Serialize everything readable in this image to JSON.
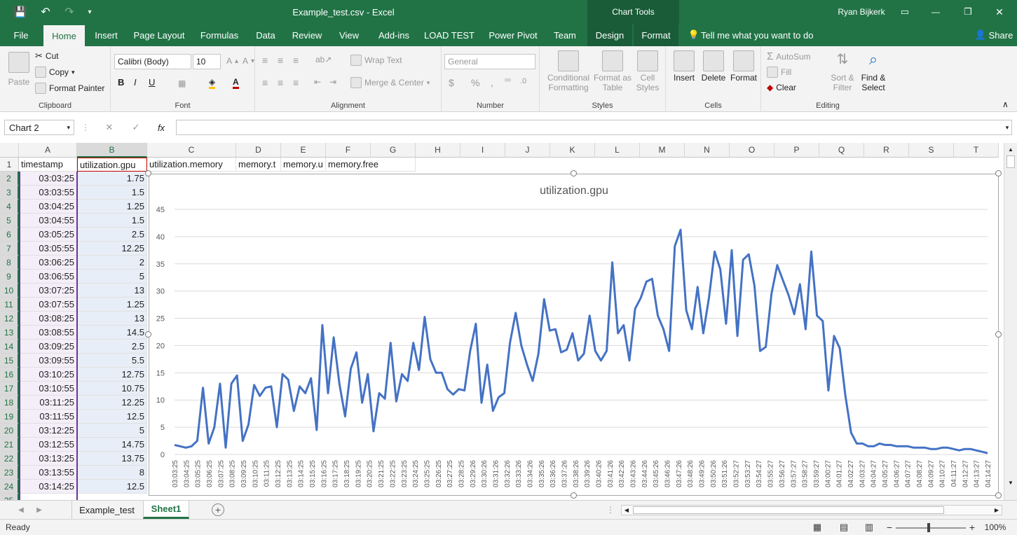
{
  "window": {
    "title": "Example_test.csv  -  Excel",
    "context_tab": "Chart Tools",
    "user": "Ryan Bijkerk",
    "minimize": "—",
    "restore": "❐",
    "close": "✕"
  },
  "tabs": [
    "File",
    "Home",
    "Insert",
    "Page Layout",
    "Formulas",
    "Data",
    "Review",
    "View",
    "Add-ins",
    "LOAD TEST",
    "Power Pivot",
    "Team",
    "Design",
    "Format"
  ],
  "tell_me": "Tell me what you want to do",
  "share": "Share",
  "ribbon": {
    "clipboard": {
      "label": "Clipboard",
      "paste": "Paste",
      "cut": "Cut",
      "copy": "Copy",
      "format_painter": "Format Painter"
    },
    "font": {
      "label": "Font",
      "family": "Calibri (Body)",
      "size": "10",
      "bold": "B",
      "italic": "I",
      "underline": "U"
    },
    "alignment": {
      "label": "Alignment",
      "wrap": "Wrap Text",
      "merge": "Merge & Center"
    },
    "number": {
      "label": "Number",
      "format": "General",
      "currency": "$",
      "percent": "%",
      "comma": ",",
      "inc": "⁰⁰",
      "dec": ".0"
    },
    "styles": {
      "label": "Styles",
      "conditional": "Conditional",
      "conditional2": "Formatting",
      "format_as": "Format as",
      "format_as2": "Table",
      "cell": "Cell",
      "cell2": "Styles"
    },
    "cells": {
      "label": "Cells",
      "insert": "Insert",
      "delete": "Delete",
      "format": "Format"
    },
    "editing": {
      "label": "Editing",
      "autosum": "AutoSum",
      "fill": "Fill",
      "clear": "Clear",
      "sort": "Sort &",
      "sort2": "Filter",
      "find": "Find &",
      "find2": "Select"
    }
  },
  "formula_bar": {
    "name_box": "Chart 2",
    "cancel": "✕",
    "enter": "✓",
    "fx": "fx",
    "value": ""
  },
  "columns": [
    "A",
    "B",
    "C",
    "D",
    "E",
    "F",
    "G",
    "H",
    "I",
    "J",
    "K",
    "L",
    "M",
    "N",
    "O",
    "P",
    "Q",
    "R",
    "S",
    "T"
  ],
  "header_row": [
    "timestamp",
    "utilization.gpu",
    "utilization.memory",
    "memory.t",
    "memory.u",
    "memory.free"
  ],
  "rows": [
    [
      "03:03:25",
      "1.75"
    ],
    [
      "03:03:55",
      "1.5"
    ],
    [
      "03:04:25",
      "1.25"
    ],
    [
      "03:04:55",
      "1.5"
    ],
    [
      "03:05:25",
      "2.5"
    ],
    [
      "03:05:55",
      "12.25"
    ],
    [
      "03:06:25",
      "2"
    ],
    [
      "03:06:55",
      "5"
    ],
    [
      "03:07:25",
      "13"
    ],
    [
      "03:07:55",
      "1.25"
    ],
    [
      "03:08:25",
      "13"
    ],
    [
      "03:08:55",
      "14.5"
    ],
    [
      "03:09:25",
      "2.5"
    ],
    [
      "03:09:55",
      "5.5"
    ],
    [
      "03:10:25",
      "12.75"
    ],
    [
      "03:10:55",
      "10.75"
    ],
    [
      "03:11:25",
      "12.25"
    ],
    [
      "03:11:55",
      "12.5"
    ],
    [
      "03:12:25",
      "5"
    ],
    [
      "03:12:55",
      "14.75"
    ],
    [
      "03:13:25",
      "13.75"
    ],
    [
      "03:13:55",
      "8"
    ],
    [
      "03:14:25",
      "12.5"
    ]
  ],
  "sheets": [
    "Example_test",
    "Sheet1"
  ],
  "active_sheet": "Sheet1",
  "status": {
    "ready": "Ready",
    "zoom": "100%"
  },
  "chart_data": {
    "type": "line",
    "title": "utilization.gpu",
    "ylim": [
      0,
      45
    ],
    "yticks": [
      0,
      5,
      10,
      15,
      20,
      25,
      30,
      35,
      40,
      45
    ],
    "grid": true,
    "color": "#4472C4",
    "x_tick_labels": [
      "03:03:25",
      "03:04:25",
      "03:05:25",
      "03:06:25",
      "03:07:25",
      "03:08:25",
      "03:09:25",
      "03:10:25",
      "03:11:25",
      "03:12:25",
      "03:13:25",
      "03:14:25",
      "03:15:25",
      "03:16:25",
      "03:17:25",
      "03:18:25",
      "03:19:25",
      "03:20:25",
      "03:21:25",
      "03:22:25",
      "03:23:25",
      "03:24:25",
      "03:25:25",
      "03:26:25",
      "03:27:25",
      "03:28:25",
      "03:29:26",
      "03:30:26",
      "03:31:26",
      "03:32:26",
      "03:33:26",
      "03:34:26",
      "03:35:26",
      "03:36:26",
      "03:37:26",
      "03:38:26",
      "03:39:26",
      "03:40:26",
      "03:41:26",
      "03:42:26",
      "03:43:26",
      "03:44:26",
      "03:45:26",
      "03:46:26",
      "03:47:26",
      "03:48:26",
      "03:49:26",
      "03:50:26",
      "03:51:26",
      "03:52:27",
      "03:53:27",
      "03:54:27",
      "03:55:27",
      "03:56:27",
      "03:57:27",
      "03:58:27",
      "03:59:27",
      "04:00:27",
      "04:01:27",
      "04:02:27",
      "04:03:27",
      "04:04:27",
      "04:05:27",
      "04:06:27",
      "04:07:27",
      "04:08:27",
      "04:09:27",
      "04:10:27",
      "04:11:27",
      "04:12:27",
      "04:13:27",
      "04:14:27"
    ],
    "values": [
      1.75,
      1.5,
      1.25,
      1.5,
      2.5,
      12.25,
      2,
      5,
      13,
      1.25,
      13,
      14.5,
      2.5,
      5.5,
      12.75,
      10.75,
      12.25,
      12.5,
      5,
      14.75,
      13.75,
      8,
      12.5,
      11.25,
      14,
      4.5,
      23.75,
      11.25,
      21.5,
      13,
      7,
      15.75,
      18.75,
      9.5,
      14.75,
      4.25,
      11.25,
      10.25,
      20.5,
      9.75,
      14.75,
      13.5,
      20.5,
      15.5,
      25.25,
      17.5,
      15,
      15,
      12,
      11,
      12,
      11.75,
      19,
      24,
      9.5,
      16.5,
      8,
      10.5,
      11.25,
      20.5,
      26,
      20,
      16.5,
      13.5,
      18.5,
      28.5,
      22.75,
      23,
      18.75,
      19.25,
      22.25,
      17.25,
      18.5,
      25.5,
      19,
      17.25,
      19,
      35.25,
      22.25,
      23.75,
      17.25,
      26.75,
      28.75,
      31.75,
      32.25,
      25.5,
      23,
      19,
      38.25,
      41.25,
      26.5,
      23,
      30.75,
      22.25,
      28.75,
      37.25,
      34,
      24,
      37.5,
      21.75,
      35.75,
      36.75,
      31,
      19,
      19.75,
      29.5,
      34.75,
      32,
      29.25,
      25.75,
      31.25,
      23,
      37.25,
      25.5,
      24.5,
      11.75,
      21.75,
      19.5,
      10.75,
      4,
      2,
      2,
      1.5,
      1.5,
      2,
      1.75,
      1.75,
      1.5,
      1.5,
      1.5,
      1.25,
      1.25,
      1.25,
      1,
      1,
      1.25,
      1.25,
      1,
      0.75,
      1,
      1,
      0.75,
      0.5,
      0.25
    ]
  }
}
